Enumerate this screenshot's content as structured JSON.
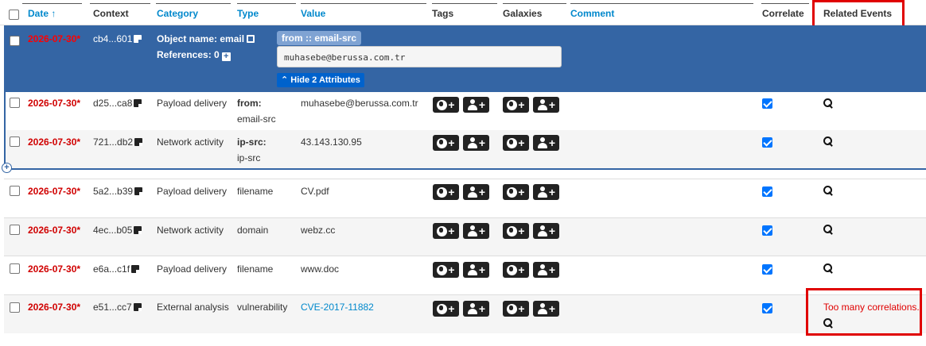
{
  "header": {
    "date": "Date",
    "sort_arrow": "↑",
    "context": "Context",
    "category": "Category",
    "type": "Type",
    "value": "Value",
    "tags": "Tags",
    "galaxies": "Galaxies",
    "comment": "Comment",
    "correlate": "Correlate",
    "related_events": "Related Events"
  },
  "object": {
    "date": "2026-07-30*",
    "context": "cb4...601",
    "name_label": "Object name: email",
    "references": "References: 0",
    "attr_tag": "from :: email-src",
    "value": "muhasebe@berussa.com.tr",
    "hide_button": "Hide 2 Attributes",
    "hide_icon": "chevron-up-double-icon"
  },
  "rows": [
    {
      "date": "2026-07-30*",
      "context": "d25...ca8",
      "category": "Payload delivery",
      "type": "from:",
      "type2": "email-src",
      "value": "muhasebe@berussa.com.tr",
      "correlate": true,
      "related": ""
    },
    {
      "date": "2026-07-30*",
      "context": "721...db2",
      "category": "Network activity",
      "type": "ip-src:",
      "type2": "ip-src",
      "value": "43.143.130.95",
      "correlate": true,
      "related": ""
    },
    {
      "date": "2026-07-30*",
      "context": "5a2...b39",
      "category": "Payload delivery",
      "type": "filename",
      "type2": "",
      "value": "CV.pdf",
      "correlate": true,
      "related": ""
    },
    {
      "date": "2026-07-30*",
      "context": "4ec...b05",
      "category": "Network activity",
      "type": "domain",
      "type2": "",
      "value": "webz.cc",
      "correlate": true,
      "related": ""
    },
    {
      "date": "2026-07-30*",
      "context": "e6a...c1f",
      "category": "Payload delivery",
      "type": "filename",
      "type2": "",
      "value": "www.doc",
      "correlate": true,
      "related": ""
    },
    {
      "date": "2026-07-30*",
      "context": "e51...cc7",
      "category": "External analysis",
      "type": "vulnerability",
      "type2": "",
      "value": "CVE-2017-11882",
      "correlate": true,
      "related": "Too many correlations."
    }
  ],
  "icons": {
    "add_tag_global": "globe-plus-icon",
    "add_tag_local": "user-plus-icon",
    "related_search": "search-icon"
  },
  "colors": {
    "object_row_bg": "#3465a4",
    "date_red": "#d00000",
    "link_blue": "#0088cc",
    "highlight_red": "#e00000"
  }
}
